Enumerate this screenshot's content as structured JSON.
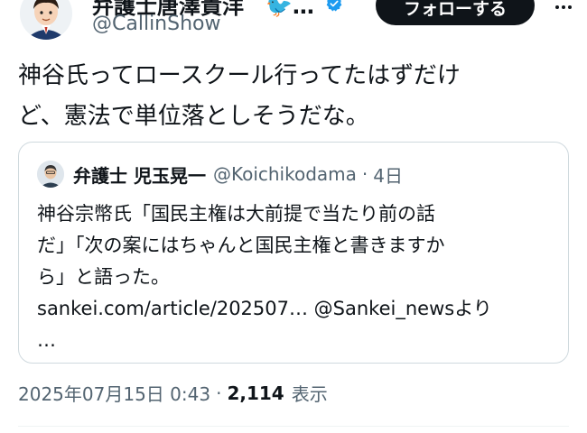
{
  "author": {
    "display_name": "弁護士唐澤貴洋　🐦…",
    "handle": "@CallinShow",
    "verified": true
  },
  "follow_button": {
    "label": "フォローする"
  },
  "tweet": {
    "lines": [
      "神谷氏ってロースクール行ってたはずだけ",
      "ど、憲法で単位落としそうだな。"
    ]
  },
  "quote": {
    "display_name": "弁護士 児玉晃一",
    "handle": "@Koichikodama",
    "separator": "·",
    "time": "4日",
    "lines": [
      "神谷宗幣氏「国民主権は大前提で当たり前の話",
      "だ」「次の案にはちゃんと国民主権と書きますか",
      "ら」と語った。",
      "sankei.com/article/202507… @Sankei_newsより",
      "…"
    ]
  },
  "meta": {
    "timestamp": "2025年07月15日 0:43",
    "separator": "·",
    "views_count": "2,114",
    "views_label": "表示"
  },
  "colors": {
    "text_primary": "#0f1419",
    "text_secondary": "#536471",
    "border": "#cfd9de",
    "verified_blue": "#1d9bf0",
    "button_bg": "#0f1419"
  }
}
